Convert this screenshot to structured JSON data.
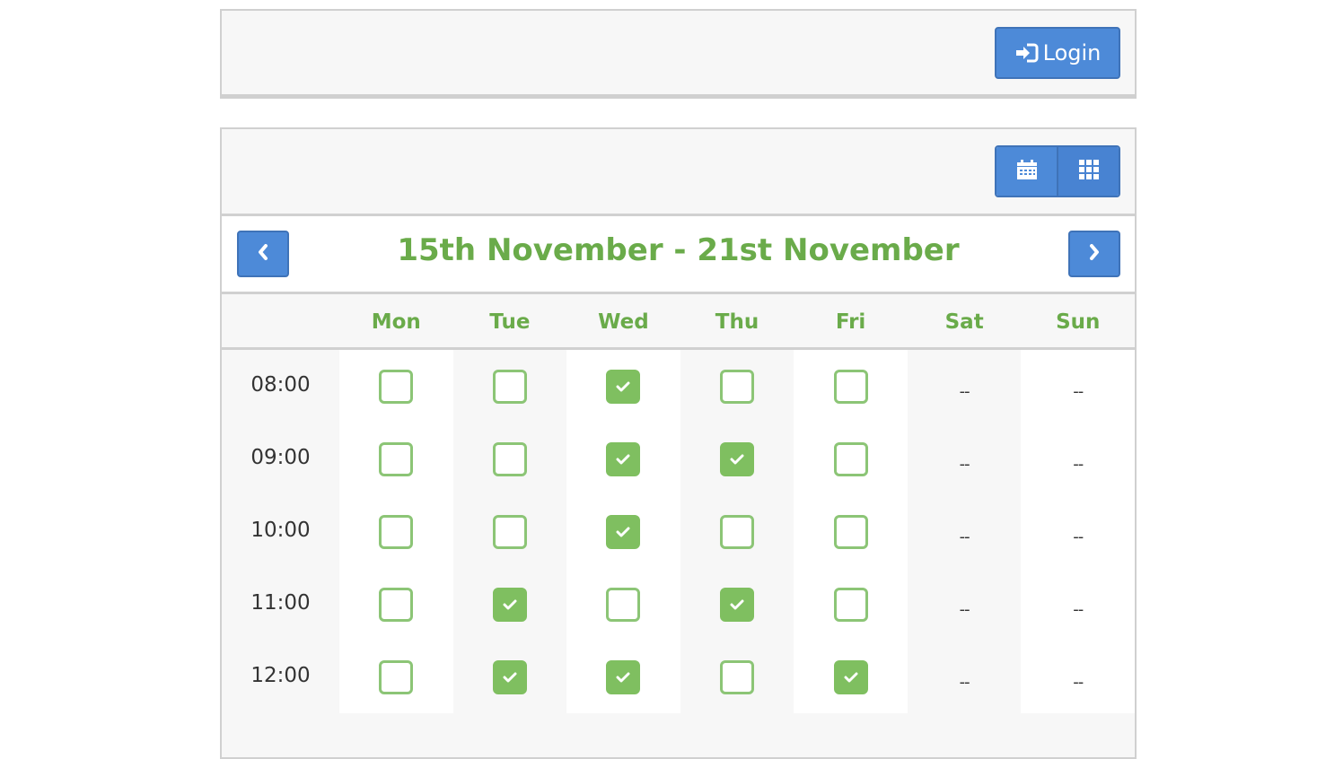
{
  "topbar": {
    "login_label": "Login",
    "login_icon": "sign-in-icon"
  },
  "toolbar": {
    "views": [
      {
        "icon": "calendar-icon"
      },
      {
        "icon": "grid-icon"
      }
    ]
  },
  "nav": {
    "range_title": "15th November - 21st November",
    "prev_icon": "chevron-left-icon",
    "next_icon": "chevron-right-icon"
  },
  "days": [
    "Mon",
    "Tue",
    "Wed",
    "Thu",
    "Fri",
    "Sat",
    "Sun"
  ],
  "empty_marker": "--",
  "rows": [
    {
      "time": "08:00",
      "slots": [
        false,
        false,
        true,
        false,
        false
      ]
    },
    {
      "time": "09:00",
      "slots": [
        false,
        false,
        true,
        true,
        false
      ]
    },
    {
      "time": "10:00",
      "slots": [
        false,
        false,
        true,
        false,
        false
      ]
    },
    {
      "time": "11:00",
      "slots": [
        false,
        true,
        false,
        true,
        false
      ]
    },
    {
      "time": "12:00",
      "slots": [
        false,
        true,
        true,
        false,
        true
      ]
    }
  ],
  "colors": {
    "accent_green": "#6aab4a",
    "checked_green": "#7fbf60",
    "button_blue": "#4d8ad8"
  }
}
